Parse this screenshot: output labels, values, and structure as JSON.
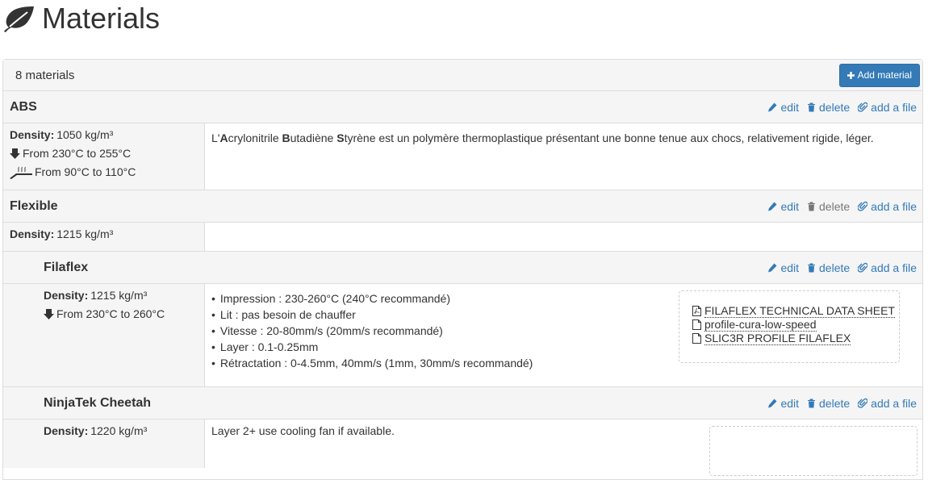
{
  "page": {
    "title": "Materials",
    "title_icon": "leaf-icon"
  },
  "panel": {
    "count_label": "8 materials",
    "add_button_label": "Add material"
  },
  "actions": {
    "edit": "edit",
    "delete": "delete",
    "add_file": "add a file"
  },
  "colors": {
    "link": "#337ab7",
    "button": "#337ab7",
    "panel_bg": "#f5f5f5",
    "border": "#dddddd"
  },
  "materials": [
    {
      "name": "ABS",
      "density_label": "Density:",
      "density_value": "1050 kg/m³",
      "extruder_temp": "From 230°C to 255°C",
      "bed_temp": "From 90°C to 110°C",
      "description": {
        "p1": "L'",
        "b1": "A",
        "p2": "crylonitrile ",
        "b2": "B",
        "p3": "utadiène ",
        "b3": "S",
        "p4": "tyrène est un polymère thermoplastique présentant une bonne tenue aux chocs, relativement rigide, léger."
      }
    },
    {
      "name": "Flexible",
      "density_label": "Density:",
      "density_value": "1215 kg/m³",
      "children": [
        {
          "name": "Filaflex",
          "density_label": "Density:",
          "density_value": "1215 kg/m³",
          "extruder_temp": "From 230°C to 260°C",
          "features": [
            "Impression : 230-260°C (240°C recommandé)",
            "Lit : pas besoin de chauffer",
            "Vitesse : 20-80mm/s (20mm/s recommandé)",
            "Layer : 0.1-0.25mm",
            "Rétractation : 0-4.5mm, 40mm/s (1mm, 30mm/s recommandé)"
          ],
          "files": [
            {
              "name": "FILAFLEX TECHNICAL DATA SHEET",
              "icon": "pdf-file-icon"
            },
            {
              "name": "profile-cura-low-speed",
              "icon": "file-icon"
            },
            {
              "name": "SLIC3R PROFILE FILAFLEX",
              "icon": "file-icon"
            }
          ]
        },
        {
          "name": "NinjaTek Cheetah",
          "density_label": "Density:",
          "density_value": "1220 kg/m³",
          "description": "Layer 2+ use cooling fan if available."
        }
      ]
    }
  ]
}
